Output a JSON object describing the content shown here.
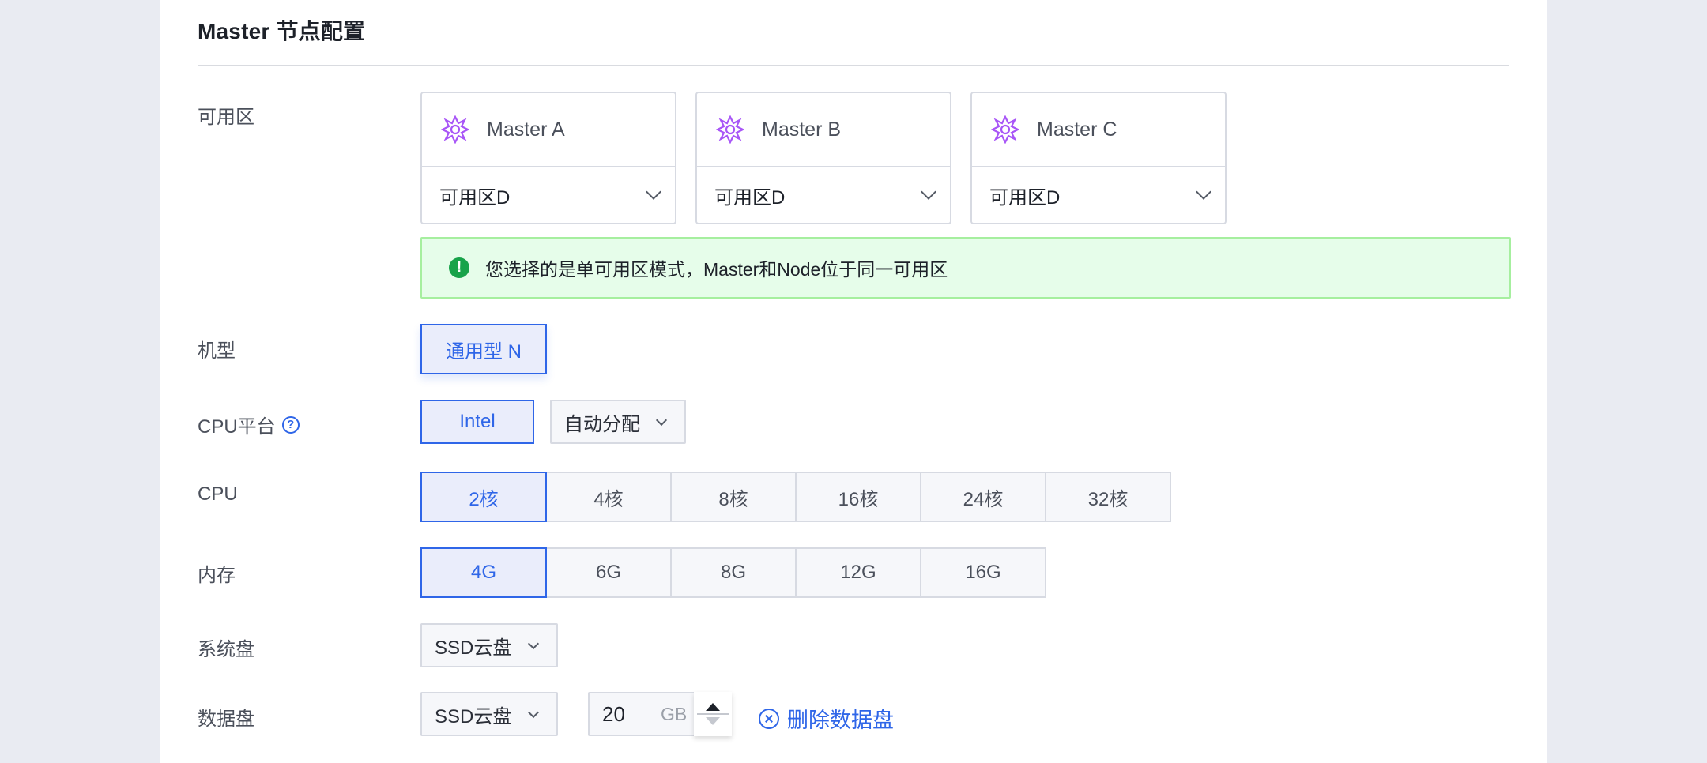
{
  "section": {
    "title": "Master 节点配置"
  },
  "labels": {
    "zone": "可用区",
    "machine_type": "机型",
    "cpu_platform": "CPU平台",
    "cpu": "CPU",
    "memory": "内存",
    "system_disk": "系统盘",
    "data_disk": "数据盘"
  },
  "zones": [
    {
      "name": "Master A",
      "zone": "可用区D",
      "icon": "master-node-icon"
    },
    {
      "name": "Master B",
      "zone": "可用区D",
      "icon": "master-node-icon"
    },
    {
      "name": "Master C",
      "zone": "可用区D",
      "icon": "master-node-icon"
    }
  ],
  "notice": {
    "icon": "exclamation-icon",
    "text": "您选择的是单可用区模式，Master和Node位于同一可用区",
    "color": "#18a34a"
  },
  "machine_type": {
    "selected": "通用型 N"
  },
  "cpu_platform": {
    "option": "Intel",
    "allocation": "自动分配",
    "help_glyph": "?"
  },
  "cpu": {
    "options": [
      "2核",
      "4核",
      "8核",
      "16核",
      "24核",
      "32核"
    ],
    "selected": "2核"
  },
  "memory": {
    "options": [
      "4G",
      "6G",
      "8G",
      "12G",
      "16G"
    ],
    "selected": "4G"
  },
  "system_disk": {
    "type": "SSD云盘"
  },
  "data_disk": {
    "type": "SSD云盘",
    "size": "20",
    "unit": "GB",
    "delete_label": "删除数据盘"
  },
  "colors": {
    "accent": "#2f66e8",
    "success_bg": "#e6fdea",
    "success_border": "#a6ef9f",
    "icon_purple": "#a855f7"
  }
}
